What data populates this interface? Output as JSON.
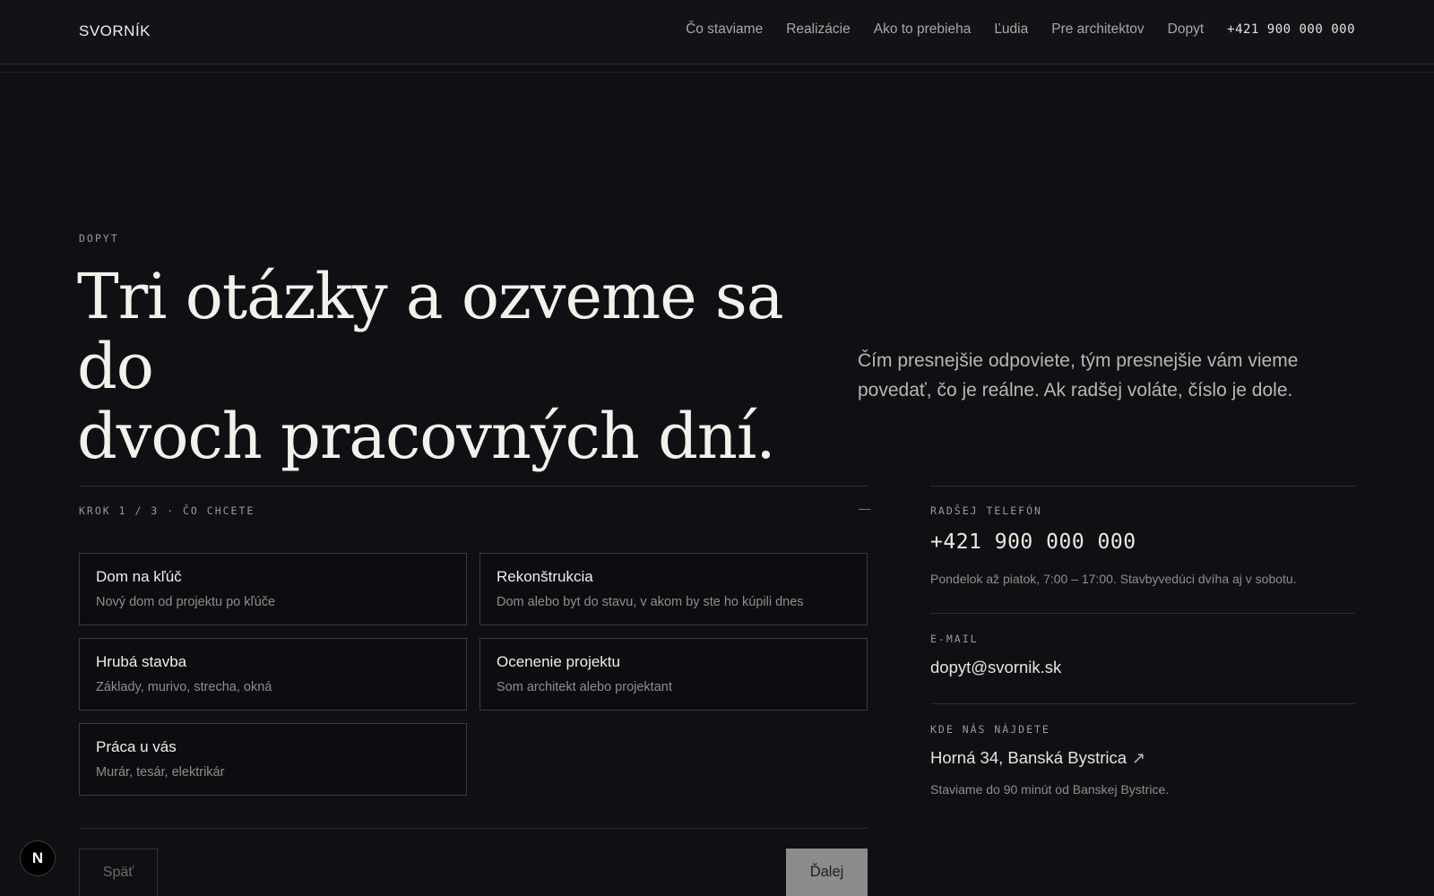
{
  "header": {
    "logo": "SVORNÍK",
    "nav": [
      "Čo staviame",
      "Realizácie",
      "Ako to prebieha",
      "Ľudia",
      "Pre architektov",
      "Dopyt"
    ],
    "phone": "+421 900 000 000"
  },
  "hero": {
    "eyebrow": "DOPYT",
    "title_line1": "Tri otázky a ozveme sa do",
    "title_line2": "dvoch pracovných dní.",
    "subtitle": "Čím presnejšie odpoviete, tým presnejšie vám vieme povedať, čo je reálne. Ak radšej voláte, číslo je dole."
  },
  "form": {
    "step_label": "KROK 1 / 3 · ČO CHCETE",
    "step_dash": "—",
    "options": [
      {
        "title": "Dom na kľúč",
        "desc": "Nový dom od projektu po kľúče"
      },
      {
        "title": "Rekonštrukcia",
        "desc": "Dom alebo byt do stavu, v akom by ste ho kúpili dnes"
      },
      {
        "title": "Hrubá stavba",
        "desc": "Základy, murivo, strecha, okná"
      },
      {
        "title": "Ocenenie projektu",
        "desc": "Som architekt alebo projektant"
      },
      {
        "title": "Práca u vás",
        "desc": "Murár, tesár, elektrikár"
      }
    ],
    "back_label": "Späť",
    "next_label": "Ďalej"
  },
  "contact": {
    "phone_label": "RADŠEJ TELEFÓN",
    "phone": "+421 900 000 000",
    "phone_note": "Pondelok až piatok, 7:00 – 17:00. Stavbyvedúci dvíha aj v sobotu.",
    "email_label": "E-MAIL",
    "email": "dopyt@svornik.sk",
    "address_label": "KDE NÁS NÁJDETE",
    "address": "Horná 34, Banská Bystrica",
    "address_note": "Staviame do 90 minút od Banskej Bystrice."
  },
  "badge": {
    "letter": "N"
  }
}
